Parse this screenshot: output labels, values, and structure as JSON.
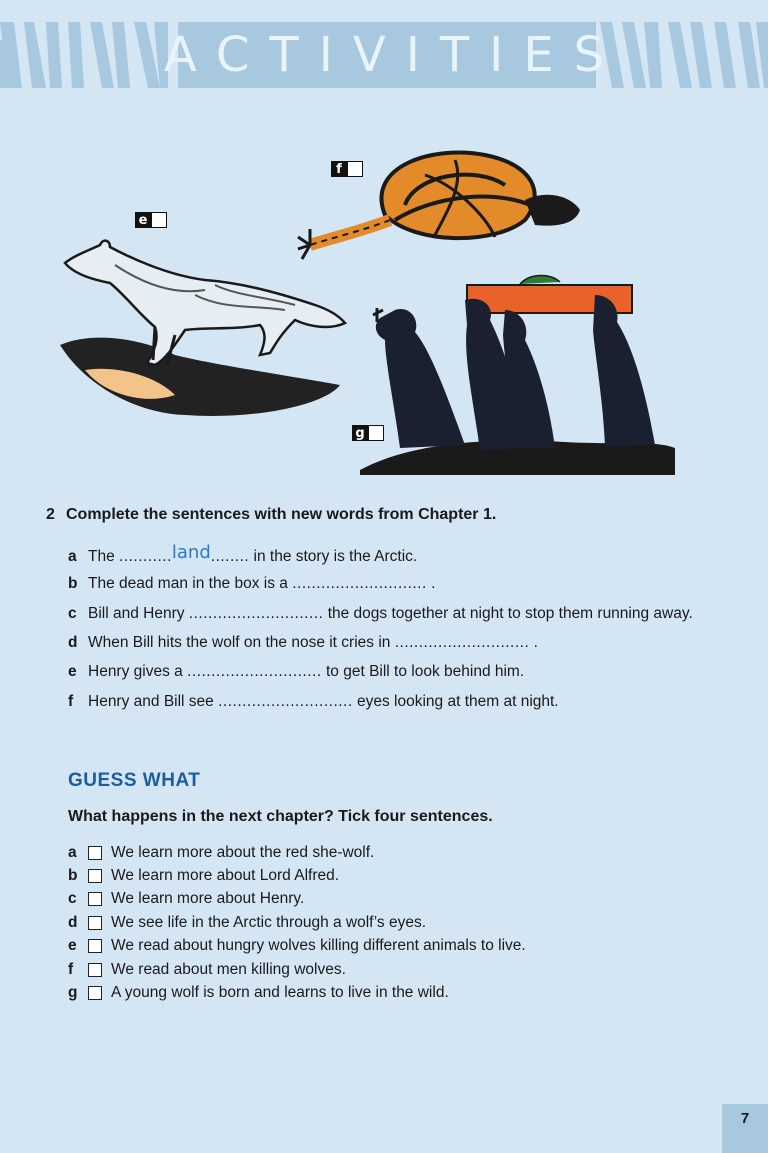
{
  "header": {
    "title": "ACTIVITIES"
  },
  "pictures": {
    "e": "e",
    "f": "f",
    "g": "g"
  },
  "exercise2": {
    "number": "2",
    "instruction": "Complete the sentences with new words from Chapter 1.",
    "items": [
      {
        "letter": "a",
        "before": "The ",
        "blank": "...........",
        "answer": "land",
        "blank_after": "........",
        "after": " in the story is the Arctic."
      },
      {
        "letter": "b",
        "before": "The dead man in the box is a ",
        "blank": "............................",
        "after": " ."
      },
      {
        "letter": "c",
        "before": "Bill and Henry ",
        "blank": "............................",
        "after": " the dogs together at night to stop them running away."
      },
      {
        "letter": "d",
        "before": "When Bill hits the wolf on the nose it cries in ",
        "blank": "............................",
        "after": " ."
      },
      {
        "letter": "e",
        "before": "Henry gives a ",
        "blank": "............................",
        "after": " to get Bill to look behind him."
      },
      {
        "letter": "f",
        "before": "Henry and Bill see ",
        "blank": "............................",
        "after": " eyes looking at them at night."
      }
    ]
  },
  "guess": {
    "heading": "GUESS WHAT",
    "instruction": "What happens in the next chapter? Tick four sentences.",
    "items": [
      {
        "letter": "a",
        "text": "We learn more about the red she-wolf."
      },
      {
        "letter": "b",
        "text": "We learn more about Lord Alfred."
      },
      {
        "letter": "c",
        "text": "We learn more about Henry."
      },
      {
        "letter": "d",
        "text": "We see life in the Arctic through a wolf’s eyes."
      },
      {
        "letter": "e",
        "text": "We read about hungry wolves killing different animals to live."
      },
      {
        "letter": "f",
        "text": "We read about men killing wolves."
      },
      {
        "letter": "g",
        "text": "A young wolf is born and learns to live in the wild."
      }
    ]
  },
  "page_number": "7",
  "colors": {
    "background": "#d4e6f3",
    "banner": "#a7c8de",
    "heading": "#1d5d9c",
    "handwriting": "#2a79c8"
  }
}
